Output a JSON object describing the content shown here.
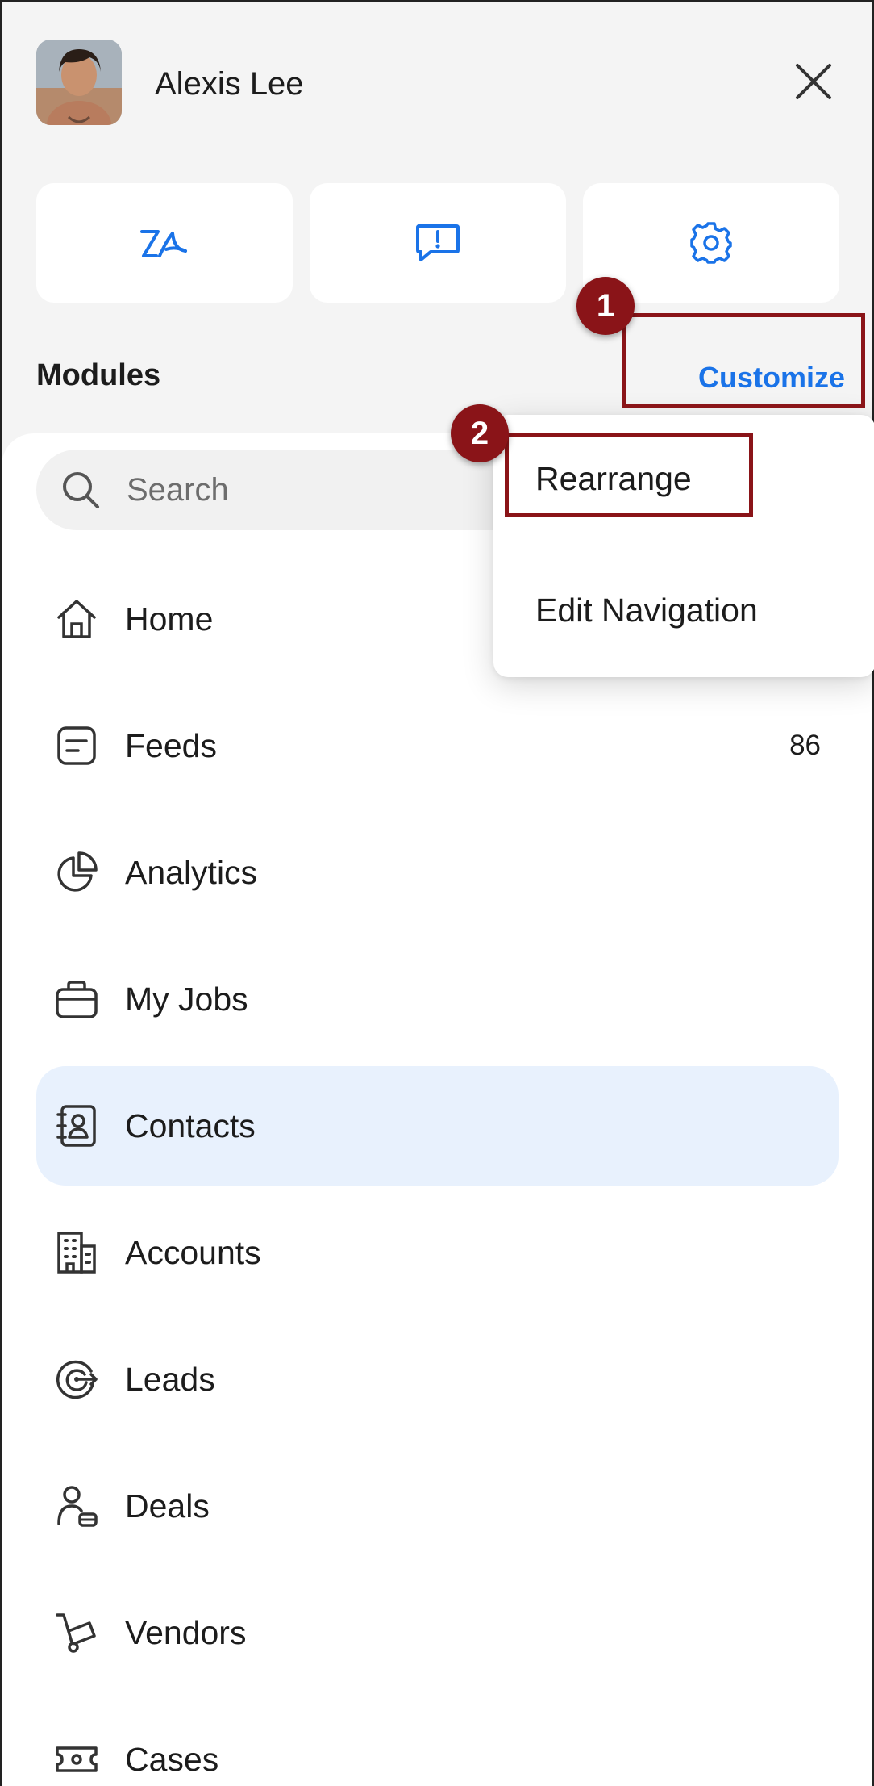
{
  "header": {
    "user_name": "Alexis Lee",
    "close_icon": "close-icon"
  },
  "quick_actions": [
    {
      "icon": "signature-icon"
    },
    {
      "icon": "feedback-icon"
    },
    {
      "icon": "gear-icon"
    }
  ],
  "modules": {
    "title": "Modules",
    "customize_label": "Customize"
  },
  "search": {
    "placeholder": "Search"
  },
  "nav_items": [
    {
      "label": "Home",
      "icon": "home-icon"
    },
    {
      "label": "Feeds",
      "icon": "feeds-icon",
      "count": "86"
    },
    {
      "label": "Analytics",
      "icon": "pie-chart-icon"
    },
    {
      "label": "My Jobs",
      "icon": "briefcase-icon"
    },
    {
      "label": "Contacts",
      "icon": "contact-book-icon",
      "active": true
    },
    {
      "label": "Accounts",
      "icon": "building-icon"
    },
    {
      "label": "Leads",
      "icon": "target-icon"
    },
    {
      "label": "Deals",
      "icon": "deals-icon"
    },
    {
      "label": "Vendors",
      "icon": "cart-icon"
    },
    {
      "label": "Cases",
      "icon": "ticket-icon"
    }
  ],
  "customize_menu": {
    "items": [
      {
        "label": "Rearrange"
      },
      {
        "label": "Edit Navigation"
      }
    ]
  },
  "annotations": {
    "step_1": "1",
    "step_2": "2"
  },
  "colors": {
    "accent": "#1a73e8",
    "active_bg": "#e8f1fd",
    "annotation": "#8a1418"
  }
}
